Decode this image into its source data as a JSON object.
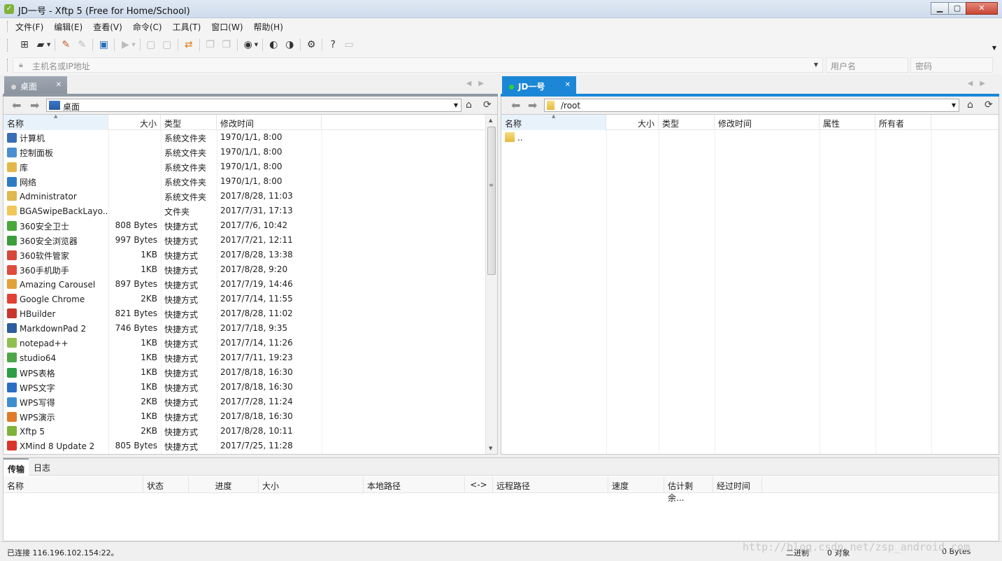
{
  "window": {
    "title": "JD一号    - Xftp 5 (Free for Home/School)",
    "app_icon": "xftp-logo-icon",
    "minimize": "▁",
    "maximize": "▢",
    "close": "✕"
  },
  "menu": [
    "文件(F)",
    "编辑(E)",
    "查看(V)",
    "命令(C)",
    "工具(T)",
    "窗口(W)",
    "帮助(H)"
  ],
  "address": {
    "host_placeholder": "主机名或IP地址",
    "user_placeholder": "用户名",
    "password_placeholder": "密码"
  },
  "left": {
    "tab_label": "桌面",
    "path": "桌面",
    "columns": [
      "名称",
      "大小",
      "类型",
      "修改时间"
    ],
    "files": [
      {
        "name": "计算机",
        "size": "",
        "type": "系统文件夹",
        "modified": "1970/1/1, 8:00",
        "color": "#3a6fb5"
      },
      {
        "name": "控制面板",
        "size": "",
        "type": "系统文件夹",
        "modified": "1970/1/1, 8:00",
        "color": "#4b8fd0"
      },
      {
        "name": "库",
        "size": "",
        "type": "系统文件夹",
        "modified": "1970/1/1, 8:00",
        "color": "#e2b84a"
      },
      {
        "name": "网络",
        "size": "",
        "type": "系统文件夹",
        "modified": "1970/1/1, 8:00",
        "color": "#2e7bc4"
      },
      {
        "name": "Administrator",
        "size": "",
        "type": "系统文件夹",
        "modified": "2017/8/28, 11:03",
        "color": "#e0b850"
      },
      {
        "name": "BGASwipeBackLayo...",
        "size": "",
        "type": "文件夹",
        "modified": "2017/7/31, 17:13",
        "color": "#efc75a"
      },
      {
        "name": "360安全卫士",
        "size": "808 Bytes",
        "type": "快捷方式",
        "modified": "2017/7/6, 10:42",
        "color": "#4aa83a"
      },
      {
        "name": "360安全浏览器",
        "size": "997 Bytes",
        "type": "快捷方式",
        "modified": "2017/7/21, 12:11",
        "color": "#3c9d3c"
      },
      {
        "name": "360软件管家",
        "size": "1KB",
        "type": "快捷方式",
        "modified": "2017/8/28, 13:38",
        "color": "#d8463a"
      },
      {
        "name": "360手机助手",
        "size": "1KB",
        "type": "快捷方式",
        "modified": "2017/8/28, 9:20",
        "color": "#e14b3b"
      },
      {
        "name": "Amazing Carousel",
        "size": "897 Bytes",
        "type": "快捷方式",
        "modified": "2017/7/19, 14:46",
        "color": "#e2a23a"
      },
      {
        "name": "Google Chrome",
        "size": "2KB",
        "type": "快捷方式",
        "modified": "2017/7/14, 11:55",
        "color": "#e34133"
      },
      {
        "name": "HBuilder",
        "size": "821 Bytes",
        "type": "快捷方式",
        "modified": "2017/8/28, 11:02",
        "color": "#c9372c"
      },
      {
        "name": "MarkdownPad 2",
        "size": "746 Bytes",
        "type": "快捷方式",
        "modified": "2017/7/18, 9:35",
        "color": "#2a5e9c"
      },
      {
        "name": "notepad++",
        "size": "1KB",
        "type": "快捷方式",
        "modified": "2017/7/14, 11:26",
        "color": "#8fbf4f"
      },
      {
        "name": "studio64",
        "size": "1KB",
        "type": "快捷方式",
        "modified": "2017/7/11, 19:23",
        "color": "#4ea64a"
      },
      {
        "name": "WPS表格",
        "size": "1KB",
        "type": "快捷方式",
        "modified": "2017/8/18, 16:30",
        "color": "#2c9e46"
      },
      {
        "name": "WPS文字",
        "size": "1KB",
        "type": "快捷方式",
        "modified": "2017/8/18, 16:30",
        "color": "#2b6dc4"
      },
      {
        "name": "WPS写得",
        "size": "2KB",
        "type": "快捷方式",
        "modified": "2017/7/28, 11:24",
        "color": "#3d8fd0"
      },
      {
        "name": "WPS演示",
        "size": "1KB",
        "type": "快捷方式",
        "modified": "2017/8/18, 16:30",
        "color": "#e07a2a"
      },
      {
        "name": "Xftp 5",
        "size": "2KB",
        "type": "快捷方式",
        "modified": "2017/8/28, 10:11",
        "color": "#7fb339"
      },
      {
        "name": "XMind 8 Update 2",
        "size": "805 Bytes",
        "type": "快捷方式",
        "modified": "2017/7/25, 11:28",
        "color": "#d9342c"
      }
    ]
  },
  "right": {
    "tab_label": "JD一号",
    "path": "/root",
    "columns": [
      "名称",
      "大小",
      "类型",
      "修改时间",
      "属性",
      "所有者"
    ],
    "files": [
      {
        "name": ".."
      }
    ]
  },
  "transfer": {
    "tabs": [
      "传输",
      "日志"
    ],
    "columns": [
      "名称",
      "状态",
      "进度",
      "大小",
      "本地路径",
      "<->",
      "远程路径",
      "速度",
      "估计剩余...",
      "经过时间"
    ]
  },
  "status": {
    "connection": "已连接 116.196.102.154:22。",
    "mode": "二进制",
    "objects": "0 对象",
    "bytes": "0 Bytes"
  },
  "watermark": "http://blog.csdn.net/zsp_android_com"
}
